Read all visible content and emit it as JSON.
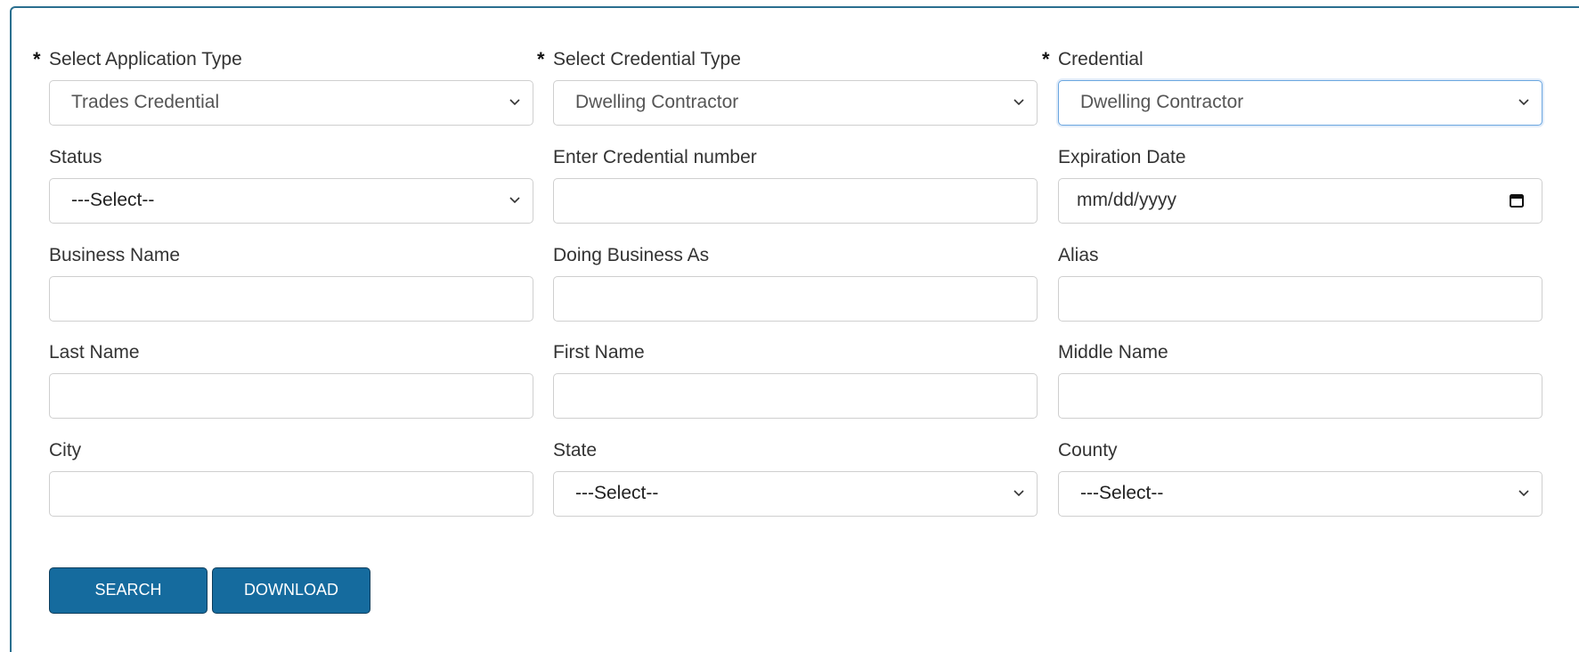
{
  "form": {
    "application_type": {
      "label": "Select Application Type",
      "required_mark": "*",
      "value": "Trades Credential"
    },
    "credential_type": {
      "label": "Select Credential Type",
      "required_mark": "*",
      "value": "Dwelling Contractor"
    },
    "credential": {
      "label": "Credential",
      "required_mark": "*",
      "value": "Dwelling Contractor"
    },
    "status": {
      "label": "Status",
      "value": "---Select--"
    },
    "credential_number": {
      "label": "Enter Credential number",
      "value": ""
    },
    "expiration_date": {
      "label": "Expiration Date",
      "placeholder": "mm/dd/yyyy"
    },
    "business_name": {
      "label": "Business Name",
      "value": ""
    },
    "doing_business_as": {
      "label": "Doing Business As",
      "value": ""
    },
    "alias": {
      "label": "Alias",
      "value": ""
    },
    "last_name": {
      "label": "Last Name",
      "value": ""
    },
    "first_name": {
      "label": "First Name",
      "value": ""
    },
    "middle_name": {
      "label": "Middle Name",
      "value": ""
    },
    "city": {
      "label": "City",
      "value": ""
    },
    "state": {
      "label": "State",
      "value": "---Select--"
    },
    "county": {
      "label": "County",
      "value": "---Select--"
    }
  },
  "actions": {
    "search_label": "SEARCH",
    "download_label": "DOWNLOAD"
  },
  "colors": {
    "panel_border": "#2a6f8f",
    "button_bg": "#156b9e",
    "focus_border": "#6aa6e0"
  },
  "icons": {
    "dropdown": "chevron-down-icon",
    "date": "calendar-icon"
  }
}
